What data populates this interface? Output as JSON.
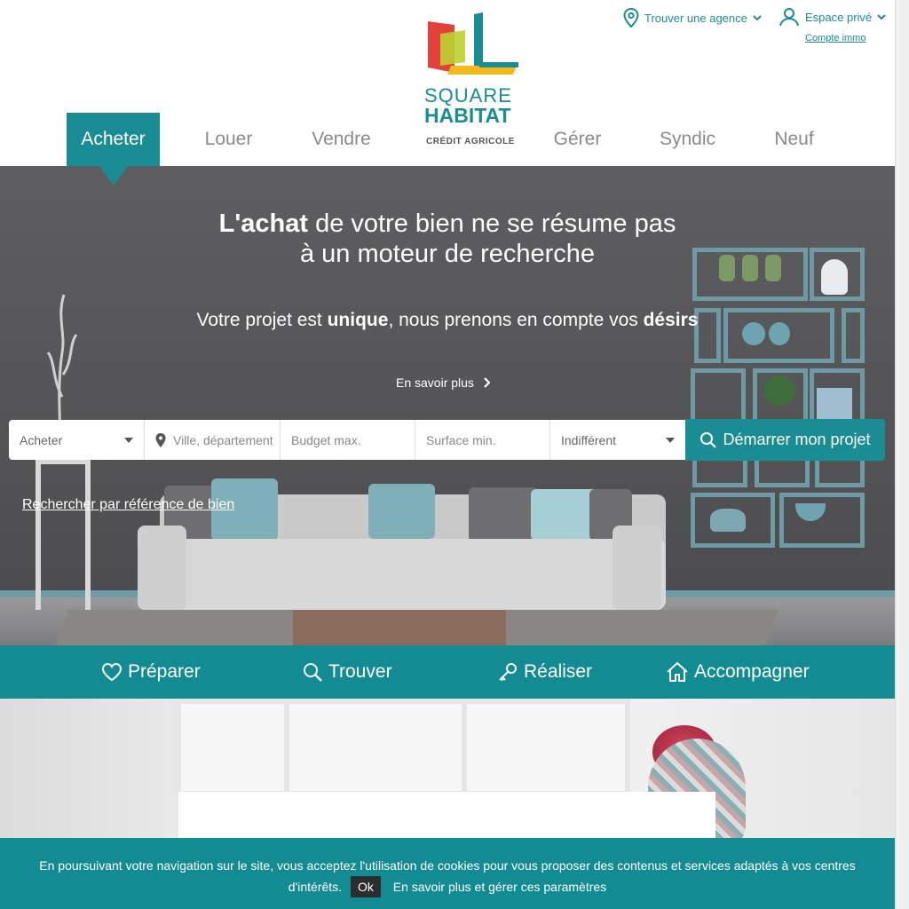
{
  "header": {
    "logo": {
      "line1": "SQUARE",
      "line2": "HABITAT",
      "line3": "CRÉDIT AGRICOLE"
    },
    "find_agency_label": "Trouver une agence",
    "private_space_label": "Espace privé",
    "account_link": "Compte immo"
  },
  "nav": {
    "items": [
      {
        "label": "Acheter",
        "active": true
      },
      {
        "label": "Louer",
        "active": false
      },
      {
        "label": "Vendre",
        "active": false
      },
      {
        "label": "Gérer",
        "active": false
      },
      {
        "label": "Syndic",
        "active": false
      },
      {
        "label": "Neuf",
        "active": false
      }
    ]
  },
  "hero": {
    "title_bold": "L'achat",
    "title_rest_line1": " de votre bien ne se résume pas",
    "title_line2": "à un moteur de recherche",
    "sub_pre": "Votre projet est ",
    "sub_bold1": "unique",
    "sub_mid": ", nous prenons en compte vos ",
    "sub_bold2": "désirs",
    "learn_more": "En savoir plus",
    "reference_link": "Rechercher par référence de bien"
  },
  "search": {
    "type_value": "Acheter",
    "location_placeholder": "Ville, département",
    "budget_placeholder": "Budget max.",
    "surface_placeholder": "Surface min.",
    "rooms_value": "Indifférent",
    "submit_label": "Démarrer mon projet"
  },
  "steps": {
    "items": [
      {
        "label": "Préparer",
        "icon": "heart-icon"
      },
      {
        "label": "Trouver",
        "icon": "search-icon"
      },
      {
        "label": "Réaliser",
        "icon": "key-icon"
      },
      {
        "label": "Accompagner",
        "icon": "home-icon"
      }
    ]
  },
  "cookie": {
    "text_line1": "En poursuivant votre navigation sur le site, vous acceptez l'utilisation de cookies pour vous proposer des contenus et services adaptés à vos centres",
    "text_line2": "d'intérêts.",
    "ok_label": "Ok",
    "settings_link": "En savoir plus et gérer ces paramètres"
  },
  "colors": {
    "brand_teal": "#1a8c93",
    "cookie_ok_bg": "#2d2d2d",
    "hero_wall": "#565658"
  }
}
